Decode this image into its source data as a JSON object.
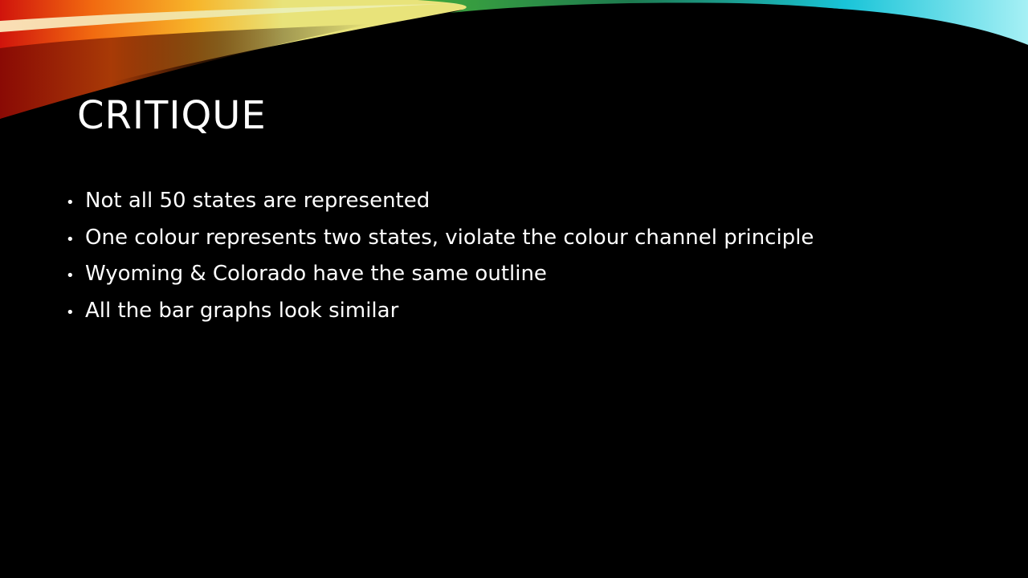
{
  "slide": {
    "title": "CRITIQUE",
    "bullet_symbol": "•",
    "bullets": [
      "Not all 50 states are represented",
      "One colour represents two states, violate the colour channel principle",
      "Wyoming & Colorado have the same outline",
      "All the bar graphs look similar"
    ]
  },
  "theme": {
    "background": "#000000",
    "text": "#ffffff",
    "banner_colors": [
      "#d0140c",
      "#f26a10",
      "#f7b52a",
      "#e8e37a",
      "#3fa83b",
      "#1d7a4f",
      "#19c4d8",
      "#a6f0f5"
    ]
  }
}
